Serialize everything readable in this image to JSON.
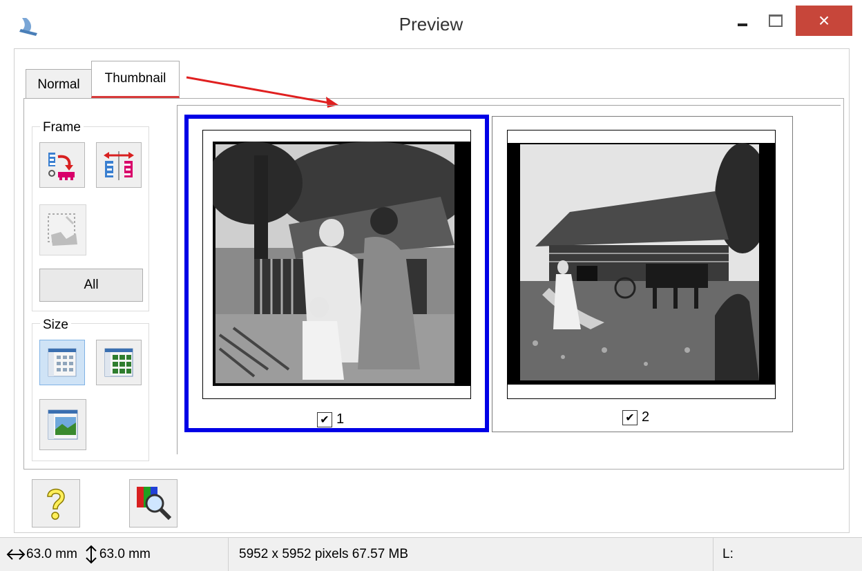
{
  "window": {
    "title": "Preview",
    "close_glyph": "×"
  },
  "tabs": [
    {
      "label": "Normal",
      "active": false
    },
    {
      "label": "Thumbnail",
      "active": true
    }
  ],
  "left_panel": {
    "frame_group_label": "Frame",
    "all_button_label": "All",
    "size_group_label": "Size",
    "frame_tools": [
      "rotate-frame-icon",
      "mirror-frame-icon",
      "auto-locate-icon"
    ],
    "size_tools": [
      "small-thumbnail-icon",
      "medium-thumbnail-icon",
      "large-thumbnail-icon"
    ]
  },
  "thumbnails": [
    {
      "label": "1",
      "checked": true,
      "selected": true
    },
    {
      "label": "2",
      "checked": true,
      "selected": false
    }
  ],
  "bottom_buttons": [
    "help-icon",
    "color-palette-icon"
  ],
  "status": {
    "width": "63.0 mm",
    "height": "63.0 mm",
    "info": "5952 x 5952 pixels 67.57 MB",
    "level": "L:"
  },
  "colors": {
    "selection_border": "#0000e6",
    "close_button": "#c7463a",
    "annotation_arrow": "#e02020"
  }
}
